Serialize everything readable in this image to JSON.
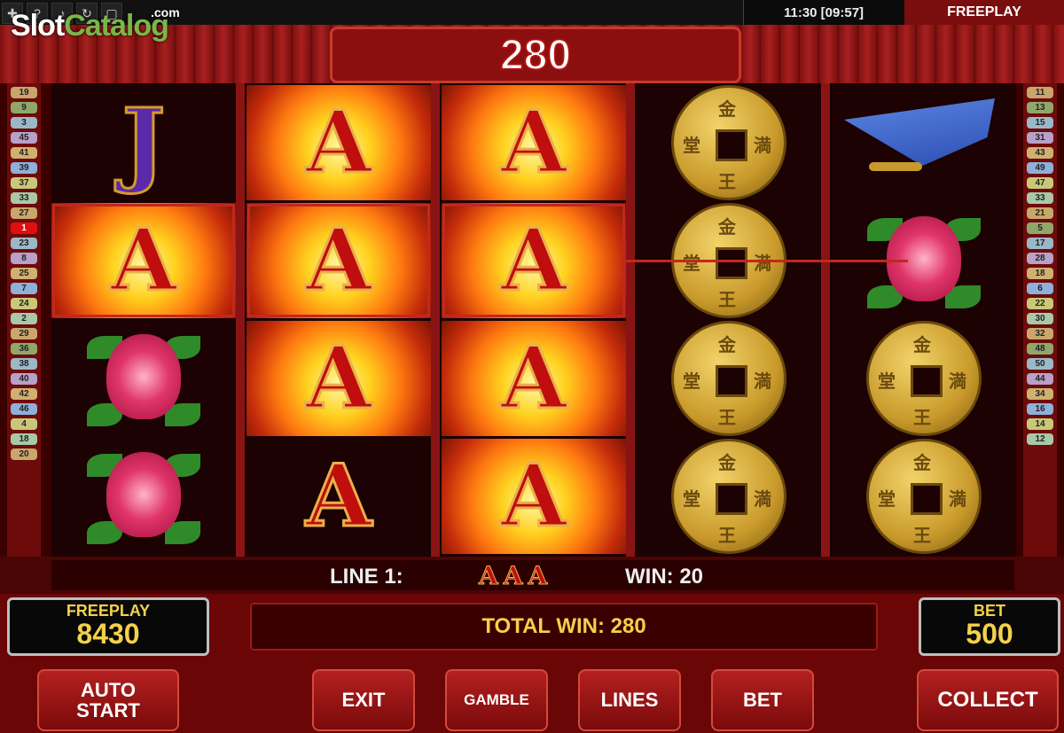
{
  "top_bar": {
    "icons": [
      "uk-flag-icon",
      "help-icon",
      "sound-icon",
      "refresh-icon",
      "fullscreen-icon"
    ],
    "clock": "11:30 [09:57]",
    "mode": "FREEPLAY"
  },
  "watermark": {
    "part1": "Slot",
    "part2": "Catalog",
    "suffix": ".com"
  },
  "win_display": "280",
  "left_line_numbers": [
    "19",
    "9",
    "3",
    "45",
    "41",
    "39",
    "37",
    "33",
    "27",
    "1",
    "23",
    "8",
    "25",
    "7",
    "24",
    "2",
    "29",
    "36",
    "38",
    "40",
    "42",
    "46",
    "4",
    "18",
    "20"
  ],
  "right_line_numbers": [
    "11",
    "13",
    "15",
    "31",
    "43",
    "49",
    "47",
    "33",
    "21",
    "5",
    "17",
    "28",
    "18",
    "6",
    "22",
    "30",
    "32",
    "48",
    "50",
    "44",
    "34",
    "16",
    "14",
    "12"
  ],
  "highlighted_line": "1",
  "reels": [
    [
      "J",
      "A",
      "flower",
      "flower"
    ],
    [
      "A",
      "A",
      "A",
      "A"
    ],
    [
      "A",
      "A",
      "A",
      "A"
    ],
    [
      "coin",
      "coin",
      "coin",
      "coin"
    ],
    [
      "fan",
      "flower",
      "coin",
      "coin"
    ]
  ],
  "line_info": {
    "label": "LINE 1:",
    "symbols": "AAA",
    "win": "WIN: 20"
  },
  "freeplay_meter": {
    "label": "FREEPLAY",
    "value": "8430"
  },
  "total_win": "TOTAL WIN: 280",
  "bet_meter": {
    "label": "BET",
    "value": "500"
  },
  "buttons": {
    "auto_start": "AUTO\nSTART",
    "exit": "EXIT",
    "gamble": "GAMBLE",
    "lines": "LINES",
    "bet": "BET",
    "collect": "COLLECT"
  },
  "colors": {
    "accent_red": "#8b0f0f",
    "gold_text": "#f3d14a"
  }
}
